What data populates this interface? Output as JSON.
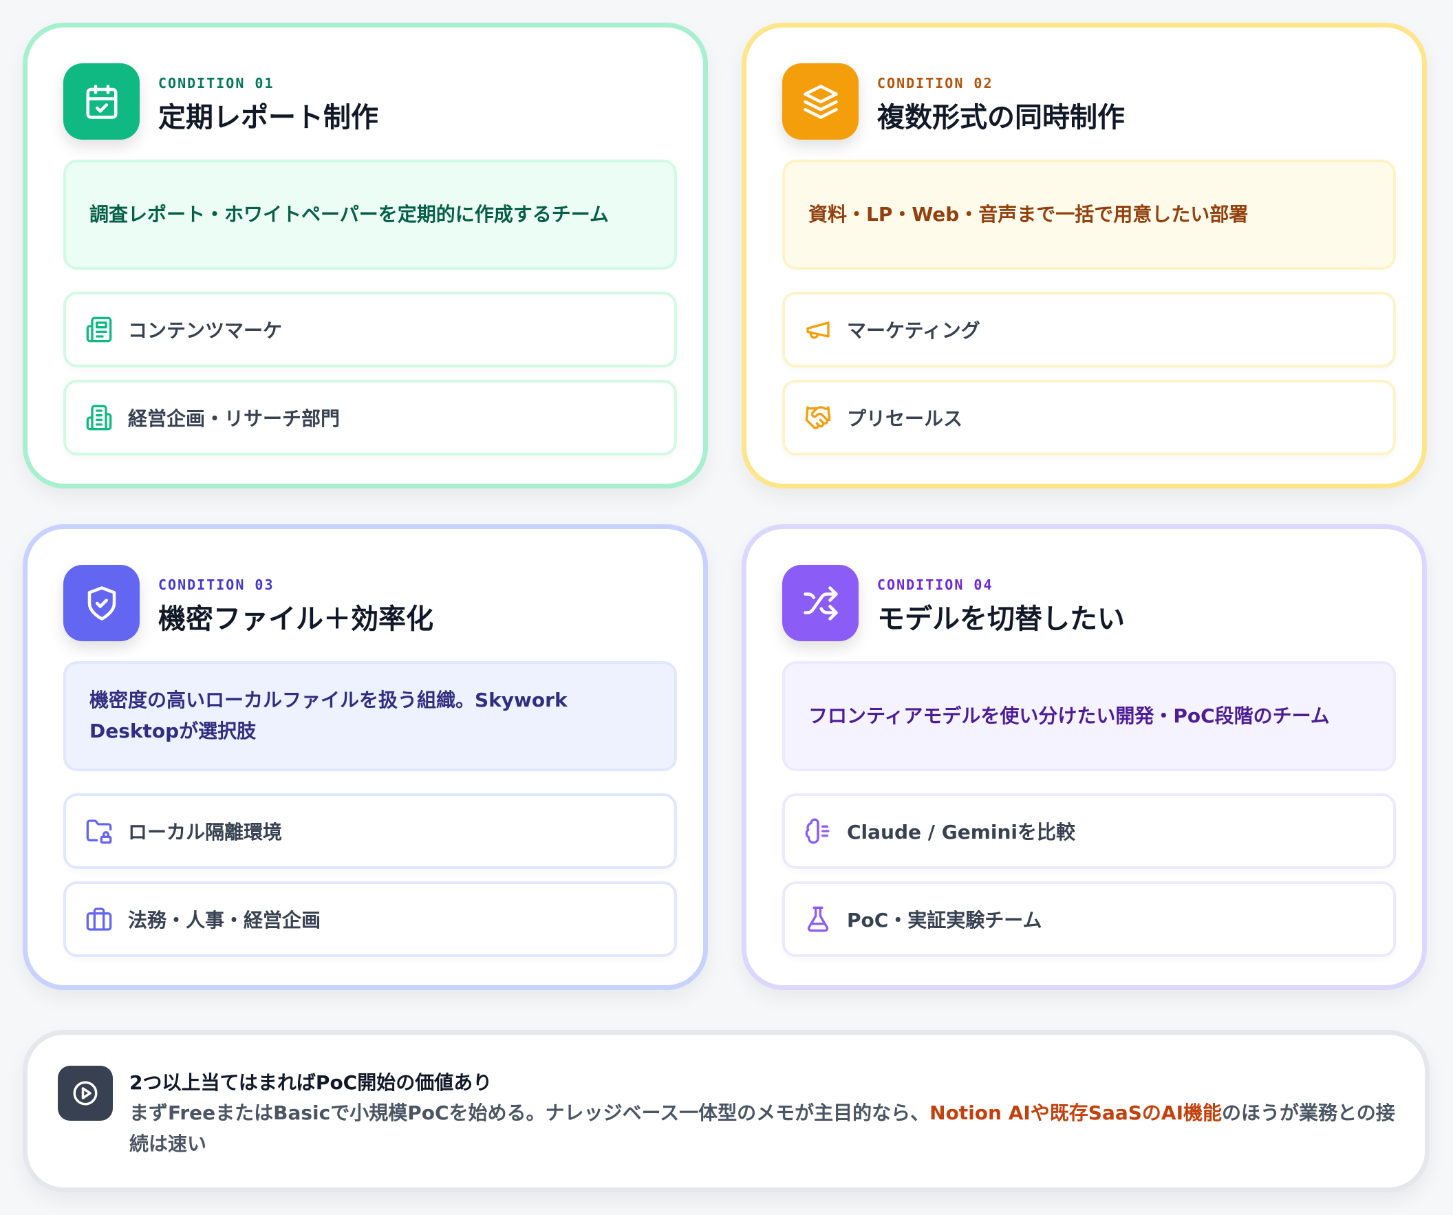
{
  "cards": [
    {
      "condition": "CONDITION 01",
      "title": "定期レポート制作",
      "description": "調査レポート・ホワイトペーパーを定期的に作成するチーム",
      "icon": "calendar-check-icon",
      "accent": "#10b981",
      "items": [
        {
          "label": "コンテンツマーケ",
          "icon": "newspaper-icon"
        },
        {
          "label": "経営企画・リサーチ部門",
          "icon": "building-icon"
        }
      ]
    },
    {
      "condition": "CONDITION 02",
      "title": "複数形式の同時制作",
      "description": "資料・LP・Web・音声まで一括で用意したい部署",
      "icon": "layers-icon",
      "accent": "#f59e0b",
      "items": [
        {
          "label": "マーケティング",
          "icon": "megaphone-icon"
        },
        {
          "label": "プリセールス",
          "icon": "handshake-icon"
        }
      ]
    },
    {
      "condition": "CONDITION 03",
      "title": "機密ファイル＋効率化",
      "description": "機密度の高いローカルファイルを扱う組織。Skywork Desktopが選択肢",
      "icon": "shield-check-icon",
      "accent": "#6366f1",
      "items": [
        {
          "label": "ローカル隔離環境",
          "icon": "folder-lock-icon"
        },
        {
          "label": "法務・人事・経営企画",
          "icon": "briefcase-icon"
        }
      ]
    },
    {
      "condition": "CONDITION 04",
      "title": "モデルを切替したい",
      "description": "フロンティアモデルを使い分けたい開発・PoC段階のチーム",
      "icon": "shuffle-icon",
      "accent": "#8b5cf6",
      "items": [
        {
          "label": "Claude / Geminiを比較",
          "icon": "brain-icon"
        },
        {
          "label": "PoC・実証実験チーム",
          "icon": "flask-icon"
        }
      ]
    }
  ],
  "summary": {
    "icon": "play-circle-icon",
    "title": "2つ以上当てはまればPoC開始の価値あり",
    "body_before": "まずFreeまたはBasicで小規模PoCを始める。ナレッジベース一体型のメモが主目的なら、",
    "body_highlight": "Notion AIや既存SaaSのAI機能",
    "body_after": "のほうが業務との接続は速い",
    "highlight_color": "#c2410c"
  }
}
